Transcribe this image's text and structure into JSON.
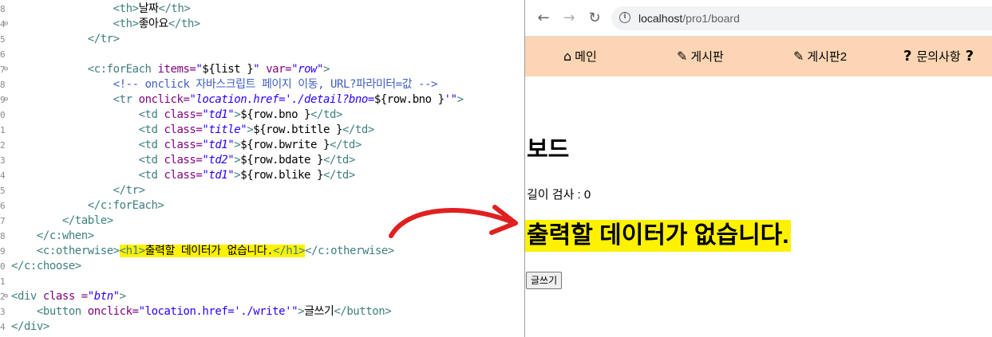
{
  "editor": {
    "lines": [
      {
        "ln": "8",
        "fold": "",
        "tokens": [
          {
            "t": "                ",
            "c": "txt"
          },
          {
            "t": "<th>",
            "c": "tag"
          },
          {
            "t": "날짜",
            "c": "txt"
          },
          {
            "t": "</th>",
            "c": "tag"
          }
        ]
      },
      {
        "ln": "4",
        "fold": "⊖",
        "tokens": [
          {
            "t": "                ",
            "c": "txt"
          },
          {
            "t": "<th>",
            "c": "tag"
          },
          {
            "t": "좋아요",
            "c": "txt"
          },
          {
            "t": "</th>",
            "c": "tag"
          }
        ]
      },
      {
        "ln": "5",
        "fold": "",
        "tokens": [
          {
            "t": "            ",
            "c": "txt"
          },
          {
            "t": "</tr>",
            "c": "tag"
          }
        ]
      },
      {
        "ln": "6",
        "fold": "",
        "tokens": []
      },
      {
        "ln": "7",
        "fold": "⊖",
        "tokens": [
          {
            "t": "            ",
            "c": "txt"
          },
          {
            "t": "<c:forEach ",
            "c": "tag"
          },
          {
            "t": "items=",
            "c": "attr"
          },
          {
            "t": "\"",
            "c": "str"
          },
          {
            "t": "${list }",
            "c": "txt"
          },
          {
            "t": "\"",
            "c": "str"
          },
          {
            "t": " var=",
            "c": "attr"
          },
          {
            "t": "\"row\"",
            "c": "str"
          },
          {
            "t": ">",
            "c": "tag"
          }
        ]
      },
      {
        "ln": "8",
        "fold": "",
        "tokens": [
          {
            "t": "                ",
            "c": "txt"
          },
          {
            "t": "<!-- onclick 자바스크립트 페이지 이동, URL?파라미터=값 -->",
            "c": "cmt"
          }
        ]
      },
      {
        "ln": "9",
        "fold": "⊖",
        "tokens": [
          {
            "t": "                ",
            "c": "txt"
          },
          {
            "t": "<tr ",
            "c": "tag"
          },
          {
            "t": "onclick=",
            "c": "attr"
          },
          {
            "t": "\"location.href='./detail?bno=",
            "c": "str"
          },
          {
            "t": "${row.bno }",
            "c": "txt"
          },
          {
            "t": "'\"",
            "c": "str"
          },
          {
            "t": ">",
            "c": "tag"
          }
        ]
      },
      {
        "ln": "0",
        "fold": "",
        "tokens": [
          {
            "t": "                    ",
            "c": "txt"
          },
          {
            "t": "<td ",
            "c": "tag"
          },
          {
            "t": "class=",
            "c": "attr"
          },
          {
            "t": "\"td1\"",
            "c": "str"
          },
          {
            "t": ">",
            "c": "tag"
          },
          {
            "t": "${row.bno }",
            "c": "txt"
          },
          {
            "t": "</td>",
            "c": "tag"
          }
        ]
      },
      {
        "ln": "1",
        "fold": "",
        "tokens": [
          {
            "t": "                    ",
            "c": "txt"
          },
          {
            "t": "<td ",
            "c": "tag"
          },
          {
            "t": "class=",
            "c": "attr"
          },
          {
            "t": "\"title\"",
            "c": "str"
          },
          {
            "t": ">",
            "c": "tag"
          },
          {
            "t": "${row.btitle }",
            "c": "txt"
          },
          {
            "t": "</td>",
            "c": "tag"
          }
        ]
      },
      {
        "ln": "2",
        "fold": "",
        "tokens": [
          {
            "t": "                    ",
            "c": "txt"
          },
          {
            "t": "<td ",
            "c": "tag"
          },
          {
            "t": "class=",
            "c": "attr"
          },
          {
            "t": "\"td1\"",
            "c": "str"
          },
          {
            "t": ">",
            "c": "tag"
          },
          {
            "t": "${row.bwrite }",
            "c": "txt"
          },
          {
            "t": "</td>",
            "c": "tag"
          }
        ]
      },
      {
        "ln": "3",
        "fold": "",
        "tokens": [
          {
            "t": "                    ",
            "c": "txt"
          },
          {
            "t": "<td ",
            "c": "tag"
          },
          {
            "t": "class=",
            "c": "attr"
          },
          {
            "t": "\"td2\"",
            "c": "str"
          },
          {
            "t": ">",
            "c": "tag"
          },
          {
            "t": "${row.bdate }",
            "c": "txt"
          },
          {
            "t": "</td>",
            "c": "tag"
          }
        ]
      },
      {
        "ln": "4",
        "fold": "",
        "tokens": [
          {
            "t": "                    ",
            "c": "txt"
          },
          {
            "t": "<td ",
            "c": "tag"
          },
          {
            "t": "class=",
            "c": "attr"
          },
          {
            "t": "\"td1\"",
            "c": "str"
          },
          {
            "t": ">",
            "c": "tag"
          },
          {
            "t": "${row.blike }",
            "c": "txt"
          },
          {
            "t": "</td>",
            "c": "tag"
          }
        ]
      },
      {
        "ln": "5",
        "fold": "",
        "tokens": [
          {
            "t": "                ",
            "c": "txt"
          },
          {
            "t": "</tr>",
            "c": "tag"
          }
        ]
      },
      {
        "ln": "6",
        "fold": "",
        "tokens": [
          {
            "t": "            ",
            "c": "txt"
          },
          {
            "t": "</c:forEach>",
            "c": "tag"
          }
        ]
      },
      {
        "ln": "7",
        "fold": "",
        "tokens": [
          {
            "t": "        ",
            "c": "txt"
          },
          {
            "t": "</table>",
            "c": "tag"
          }
        ]
      },
      {
        "ln": "8",
        "fold": "",
        "tokens": [
          {
            "t": "    ",
            "c": "txt"
          },
          {
            "t": "</c:when>",
            "c": "tag"
          }
        ]
      },
      {
        "ln": "9",
        "fold": "",
        "tokens": [
          {
            "t": "    ",
            "c": "txt"
          },
          {
            "t": "<c:otherwise>",
            "c": "tag"
          },
          {
            "t": "<h1>",
            "c": "tag",
            "hl": true
          },
          {
            "t": "출력할 데이터가 없습니다.",
            "c": "txt",
            "hl": true
          },
          {
            "t": "</h1>",
            "c": "tag",
            "hl": true
          },
          {
            "t": "</c:otherwise>",
            "c": "tag"
          }
        ]
      },
      {
        "ln": "0",
        "fold": "",
        "tokens": [
          {
            "t": "",
            "c": "txt"
          },
          {
            "t": "</c:choose>",
            "c": "tag"
          }
        ]
      },
      {
        "ln": "1",
        "fold": "",
        "tokens": []
      },
      {
        "ln": "2",
        "fold": "⊖",
        "tokens": [
          {
            "t": "",
            "c": "txt"
          },
          {
            "t": "<div ",
            "c": "tag"
          },
          {
            "t": "class =",
            "c": "attr"
          },
          {
            "t": "\"btn\"",
            "c": "str"
          },
          {
            "t": ">",
            "c": "tag"
          }
        ]
      },
      {
        "ln": "3",
        "fold": "",
        "tokens": [
          {
            "t": "    ",
            "c": "txt"
          },
          {
            "t": "<button ",
            "c": "tag"
          },
          {
            "t": "onclick=",
            "c": "attr"
          },
          {
            "t": "\"location.href='./write'\"",
            "c": "strn"
          },
          {
            "t": ">",
            "c": "tag"
          },
          {
            "t": "글쓰기",
            "c": "txt"
          },
          {
            "t": "</button>",
            "c": "tag"
          }
        ]
      },
      {
        "ln": "4",
        "fold": "",
        "tokens": [
          {
            "t": "",
            "c": "txt"
          },
          {
            "t": "</div>",
            "c": "tag"
          }
        ]
      }
    ]
  },
  "annotation": {
    "arrow_color": "#e02020"
  },
  "browser": {
    "back_icon": "arrow-left-icon",
    "forward_icon": "arrow-right-icon",
    "reload_icon": "reload-icon",
    "url_host": "localhost",
    "url_path": "/pro1/board",
    "menu": [
      {
        "label": "메인",
        "icon": "home-icon"
      },
      {
        "label": "게시판",
        "icon": "edit-icon"
      },
      {
        "label": "게시판2",
        "icon": "edit-icon"
      },
      {
        "label": "문의사항",
        "icon": "question-icon"
      }
    ],
    "menu_bg": "#fcd5b5",
    "page_title": "보드",
    "count_text": "길이 검사 : 0",
    "empty_message": "출력할 데이터가 없습니다.",
    "highlight_color": "#fff200",
    "write_button": "글쓰기"
  }
}
